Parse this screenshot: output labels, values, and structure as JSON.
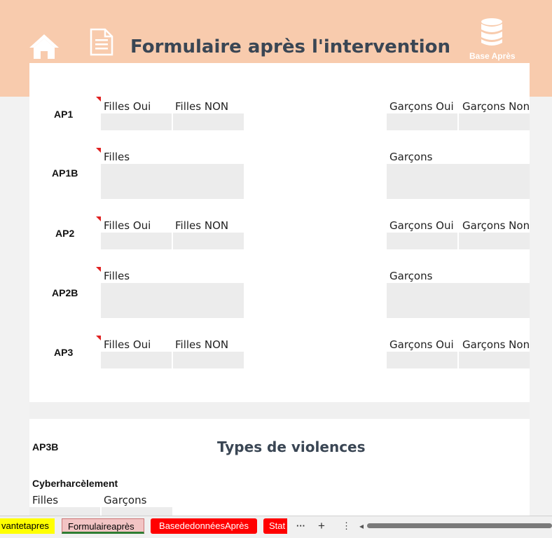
{
  "header": {
    "title": "Formulaire après l'intervention",
    "base_label": "Base Après",
    "icons": [
      "home-icon",
      "document-icon",
      "database-icon"
    ]
  },
  "rows": {
    "ap1": {
      "label": "AP1",
      "filles_oui": "Filles Oui",
      "filles_non": "Filles NON",
      "garcons_oui": "Garçons Oui",
      "garcons_non": "Garçons Non"
    },
    "ap1b": {
      "label": "AP1B",
      "filles": "Filles",
      "garcons": "Garçons"
    },
    "ap2": {
      "label": "AP2",
      "filles_oui": "Filles Oui",
      "filles_non": "Filles NON",
      "garcons_oui": "Garçons Oui",
      "garcons_non": "Garçons Non"
    },
    "ap2b": {
      "label": "AP2B",
      "filles": "Filles",
      "garcons": "Garçons"
    },
    "ap3": {
      "label": "AP3",
      "filles_oui": "Filles Oui",
      "filles_non": "Filles NON",
      "garcons_oui": "Garçons Oui",
      "garcons_non": "Garçons Non"
    }
  },
  "section": {
    "ap3b": "AP3B",
    "title": "Types de violences",
    "cyber": "Cyberharcèlement",
    "filles": "Filles",
    "garcons": "Garçons"
  },
  "tabs": {
    "tab1": "vantetapres",
    "tab2": "Formulaireaprès",
    "tab3": "BasededonnéesAprès",
    "tab4": "Stat",
    "more": "···",
    "add": "+",
    "menu": "⋮",
    "left_arrow": "◂"
  },
  "colors": {
    "banner": "#f8cbad",
    "title": "#3a4654",
    "tab_yellow": "#ffff00",
    "tab_red": "#ff0000",
    "comment_marker": "#e02020"
  }
}
